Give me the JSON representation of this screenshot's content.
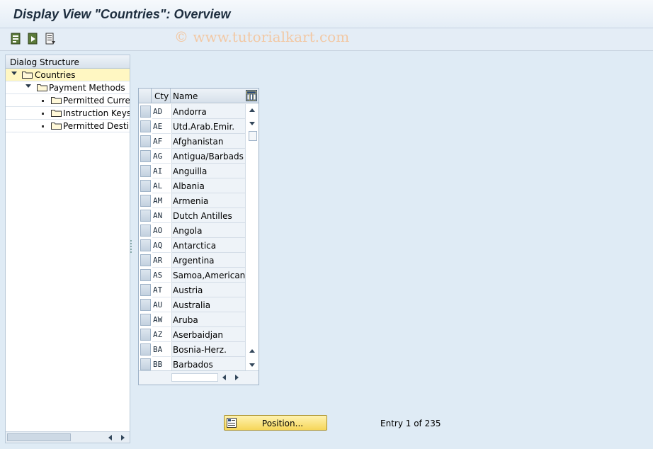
{
  "window": {
    "title": "Display View \"Countries\": Overview"
  },
  "watermark": "© www.tutorialkart.com",
  "toolbar": {
    "buttons": [
      "details-icon",
      "export-icon",
      "print-icon"
    ]
  },
  "dialog_structure": {
    "header": "Dialog Structure",
    "items": [
      {
        "label": "Countries",
        "level": 0,
        "expanded": true,
        "selected": true
      },
      {
        "label": "Payment Methods",
        "level": 1,
        "expanded": true,
        "selected": false
      },
      {
        "label": "Permitted Curren",
        "level": 2,
        "selected": false
      },
      {
        "label": "Instruction Keys",
        "level": 2,
        "selected": false
      },
      {
        "label": "Permitted Destin",
        "level": 2,
        "selected": false
      }
    ]
  },
  "table": {
    "columns": [
      "Cty",
      "Name"
    ],
    "rows": [
      {
        "code": "AD",
        "name": "Andorra"
      },
      {
        "code": "AE",
        "name": "Utd.Arab.Emir."
      },
      {
        "code": "AF",
        "name": "Afghanistan"
      },
      {
        "code": "AG",
        "name": "Antigua/Barbads"
      },
      {
        "code": "AI",
        "name": "Anguilla"
      },
      {
        "code": "AL",
        "name": "Albania"
      },
      {
        "code": "AM",
        "name": "Armenia"
      },
      {
        "code": "AN",
        "name": "Dutch Antilles"
      },
      {
        "code": "AO",
        "name": "Angola"
      },
      {
        "code": "AQ",
        "name": "Antarctica"
      },
      {
        "code": "AR",
        "name": "Argentina"
      },
      {
        "code": "AS",
        "name": "Samoa,American"
      },
      {
        "code": "AT",
        "name": "Austria"
      },
      {
        "code": "AU",
        "name": "Australia"
      },
      {
        "code": "AW",
        "name": "Aruba"
      },
      {
        "code": "AZ",
        "name": "Aserbaidjan"
      },
      {
        "code": "BA",
        "name": "Bosnia-Herz."
      },
      {
        "code": "BB",
        "name": "Barbados"
      }
    ]
  },
  "position_button": {
    "label": "Position..."
  },
  "entry_info": "Entry 1 of 235",
  "colors": {
    "background": "#dfebf5",
    "selected_tree": "#fff7c2",
    "button_yellow": "#f6d65a"
  }
}
